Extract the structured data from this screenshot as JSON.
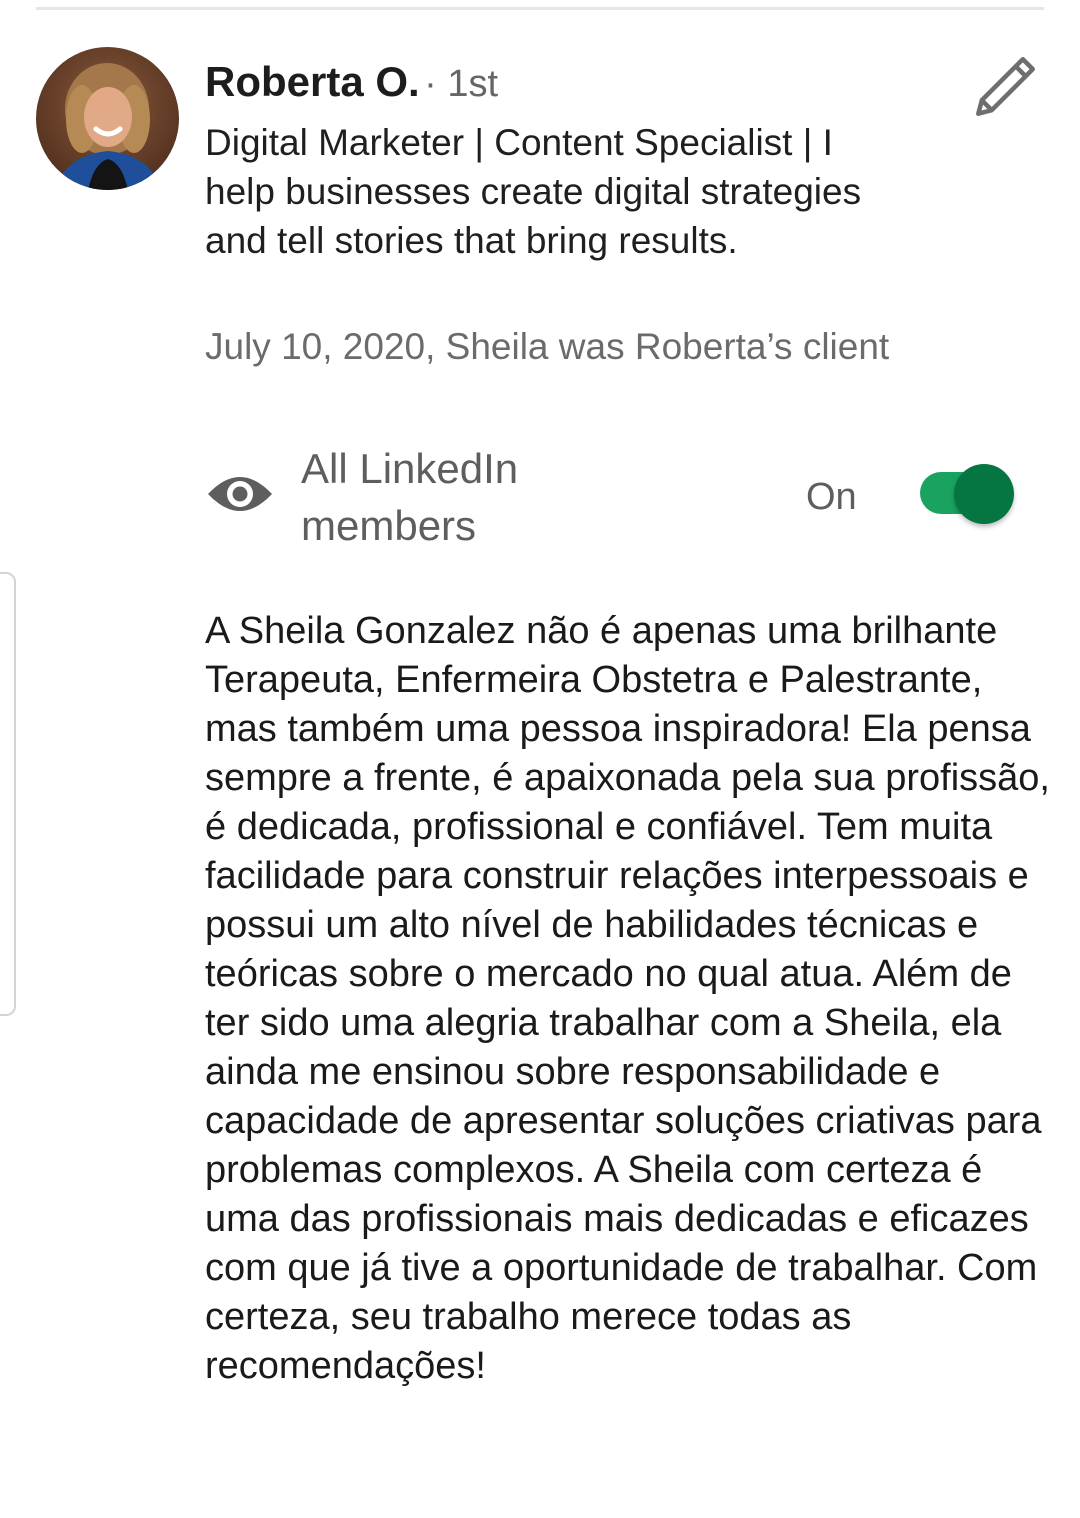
{
  "recommender": {
    "name": "Roberta O.",
    "connection_degree": "· 1st",
    "headline": "Digital Marketer | Content Specialist | I help businesses create digital strategies and tell stories that bring results.",
    "relationship": "July 10, 2020, Sheila was Roberta’s client",
    "avatar_icon": "profile-photo"
  },
  "edit": {
    "icon": "pencil-icon"
  },
  "visibility": {
    "icon": "eye-icon",
    "label": "All LinkedIn members",
    "state_label": "On",
    "enabled": true,
    "track_color": "#1aa260",
    "thumb_color": "#057642"
  },
  "recommendation": {
    "text": "A Sheila Gonzalez não é apenas uma brilhante Terapeuta, Enfermeira Obstetra e Palestrante, mas também uma pessoa inspiradora! Ela pensa sempre a frente, é apaixonada pela sua profissão, é dedicada, profissional e confiável. Tem muita facilidade para construir relações interpessoais e possui um alto nível de habilidades técnicas e teóricas sobre o mercado no qual atua. Além de ter sido uma alegria trabalhar com a Sheila, ela ainda me ensinou sobre responsabilidade e capacidade de apresentar soluções criativas para problemas complexos. A Sheila com certeza é uma das profissionais mais dedicadas e eficazes com que já tive a oportunidade de trabalhar. Com certeza, seu trabalho merece todas as recomendações!"
  }
}
